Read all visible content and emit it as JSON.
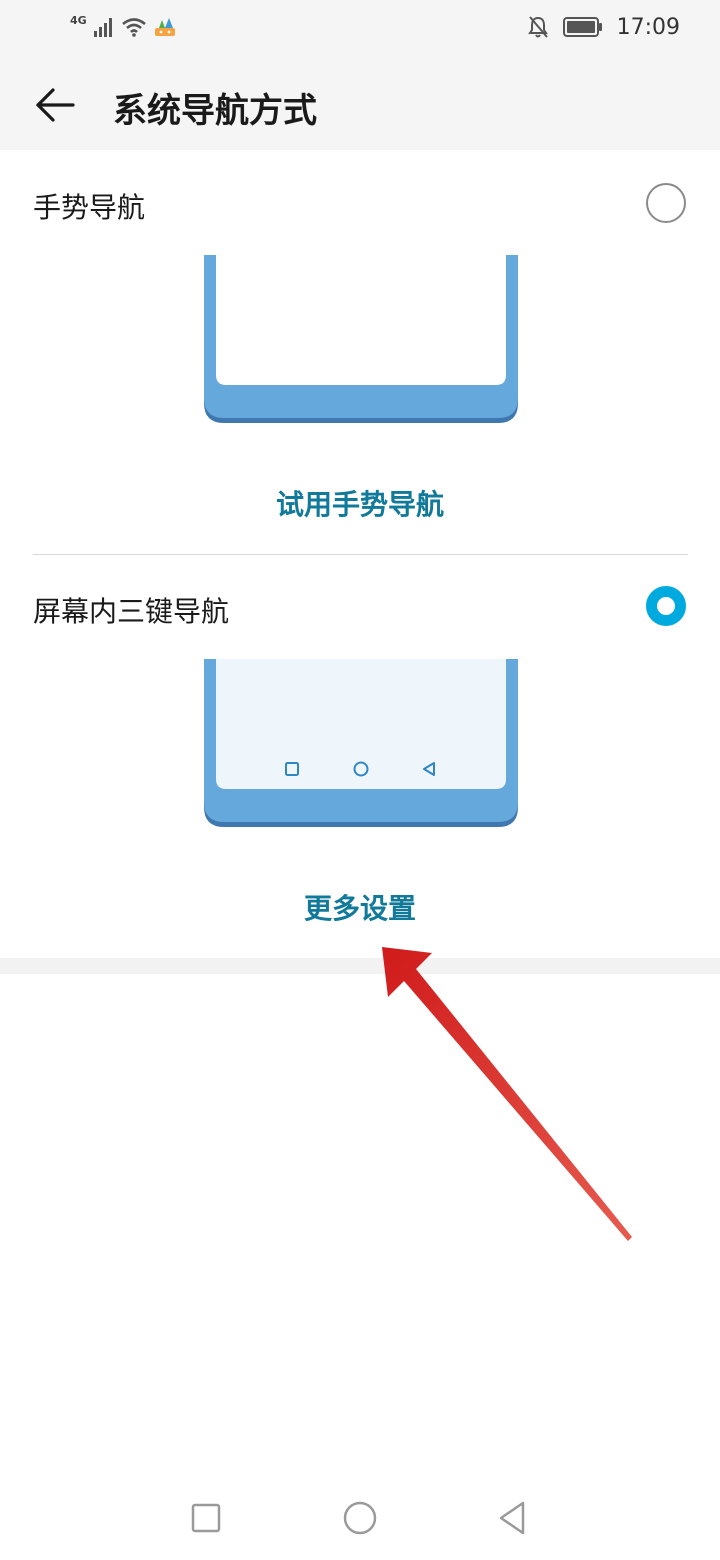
{
  "status_bar": {
    "network": "4G",
    "time": "17:09",
    "icons": [
      "signal-icon",
      "wifi-icon",
      "notification-app-icon",
      "mute-bell-icon",
      "battery-icon"
    ]
  },
  "header": {
    "title": "系统导航方式",
    "back_icon": "arrow-left-icon"
  },
  "options": [
    {
      "label": "手势导航",
      "selected": false,
      "action": "试用手势导航"
    },
    {
      "label": "屏幕内三键导航",
      "selected": true,
      "action": "更多设置"
    }
  ],
  "colors": {
    "accent": "#00aadf",
    "link": "#117a9a",
    "phone_frame": "#65a8dc",
    "annotation_arrow": "#d9201f"
  },
  "system_nav": [
    "square-icon",
    "circle-icon",
    "triangle-back-icon"
  ]
}
